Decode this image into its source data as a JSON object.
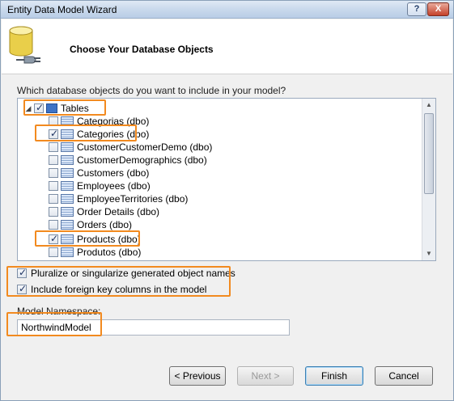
{
  "window": {
    "title": "Entity Data Model Wizard",
    "help_label": "?",
    "close_label": "X"
  },
  "header": {
    "title": "Choose Your Database Objects"
  },
  "question": "Which database objects do you want to include in your model?",
  "tree": {
    "root": {
      "label": "Tables",
      "checked": true,
      "expanded": true
    },
    "items": [
      {
        "label": "Categorias (dbo)",
        "checked": false
      },
      {
        "label": "Categories (dbo)",
        "checked": true
      },
      {
        "label": "CustomerCustomerDemo (dbo)",
        "checked": false
      },
      {
        "label": "CustomerDemographics (dbo)",
        "checked": false
      },
      {
        "label": "Customers (dbo)",
        "checked": false
      },
      {
        "label": "Employees (dbo)",
        "checked": false
      },
      {
        "label": "EmployeeTerritories (dbo)",
        "checked": false
      },
      {
        "label": "Order Details (dbo)",
        "checked": false
      },
      {
        "label": "Orders (dbo)",
        "checked": false
      },
      {
        "label": "Products (dbo)",
        "checked": true
      },
      {
        "label": "Produtos (dbo)",
        "checked": false
      }
    ]
  },
  "options": {
    "pluralize": {
      "label": "Pluralize or singularize generated object names",
      "checked": true
    },
    "foreign_keys": {
      "label": "Include foreign key columns in the model",
      "checked": true
    }
  },
  "namespace": {
    "label": "Model Namespace:",
    "value": "NorthwindModel"
  },
  "buttons": {
    "previous": "< Previous",
    "next": "Next >",
    "finish": "Finish",
    "cancel": "Cancel"
  },
  "colors": {
    "highlight": "#f28a1f",
    "titlebar": "#c9d9ec",
    "dialog_bg": "#f0f0f0"
  }
}
